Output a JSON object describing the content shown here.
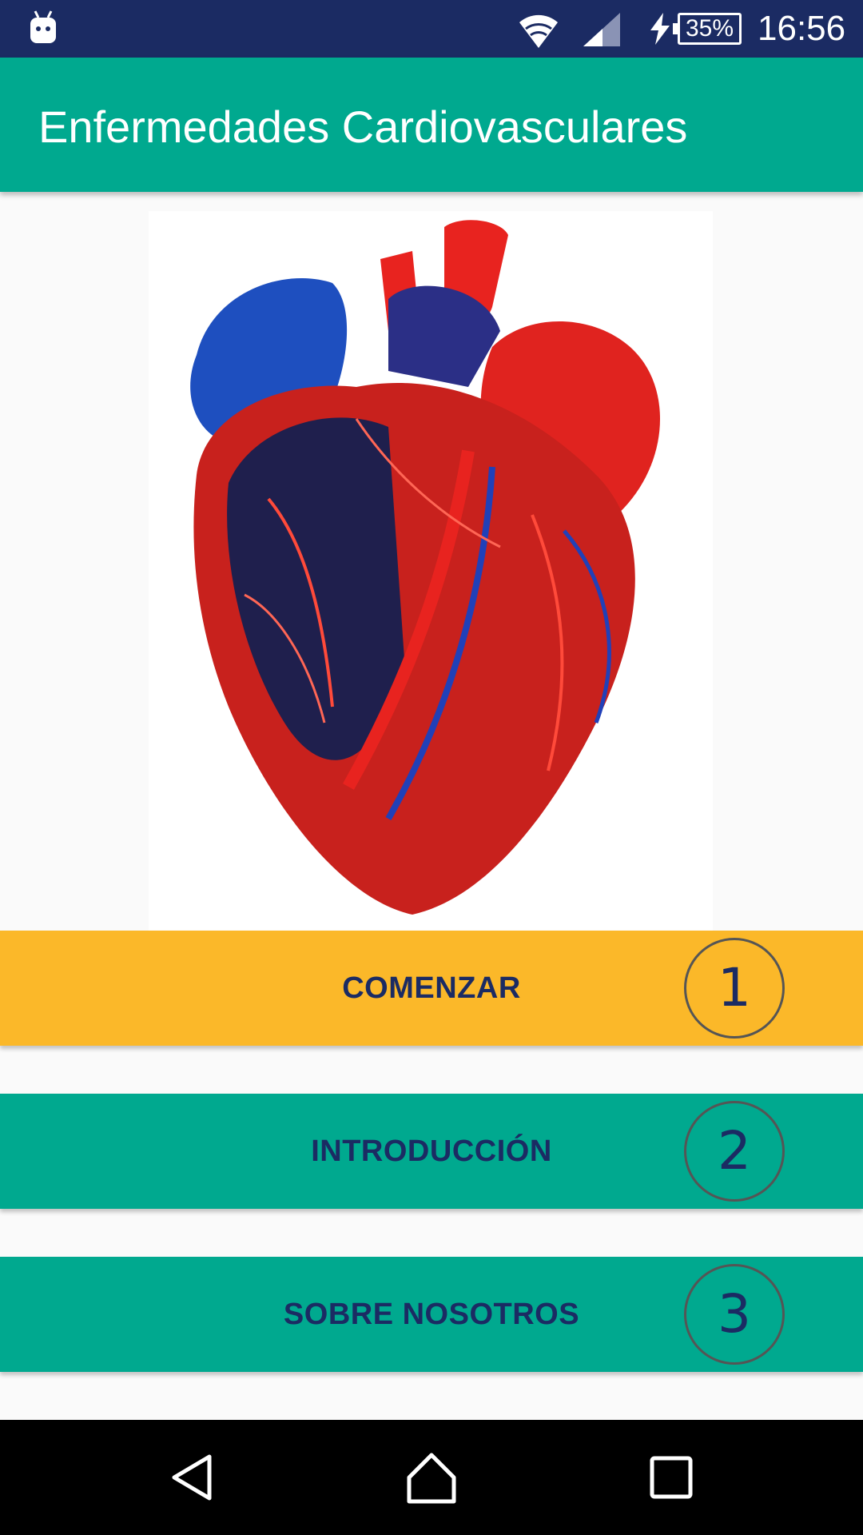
{
  "status_bar": {
    "time": "16:56",
    "battery": "35%",
    "icons": [
      "android-robot-icon",
      "wifi-icon",
      "cell-signal-icon",
      "charging-icon",
      "battery-icon"
    ]
  },
  "app_bar": {
    "title": "Enfermedades Cardiovasculares"
  },
  "hero_image": {
    "subject": "heart-vascular-cast-image"
  },
  "menu": [
    {
      "label": "COMENZAR",
      "number": "1",
      "color": "#fbb829"
    },
    {
      "label": "INTRODUCCIÓN",
      "number": "2",
      "color": "#00a98f"
    },
    {
      "label": "SOBRE NOSOTROS",
      "number": "3",
      "color": "#00a98f"
    }
  ],
  "nav_bar": {
    "icons": [
      "back-icon",
      "home-icon",
      "recents-icon"
    ]
  },
  "colors": {
    "status_bar": "#1b2b63",
    "primary": "#00a98f",
    "accent": "#fbb829",
    "button_text": "#1b2b63"
  }
}
